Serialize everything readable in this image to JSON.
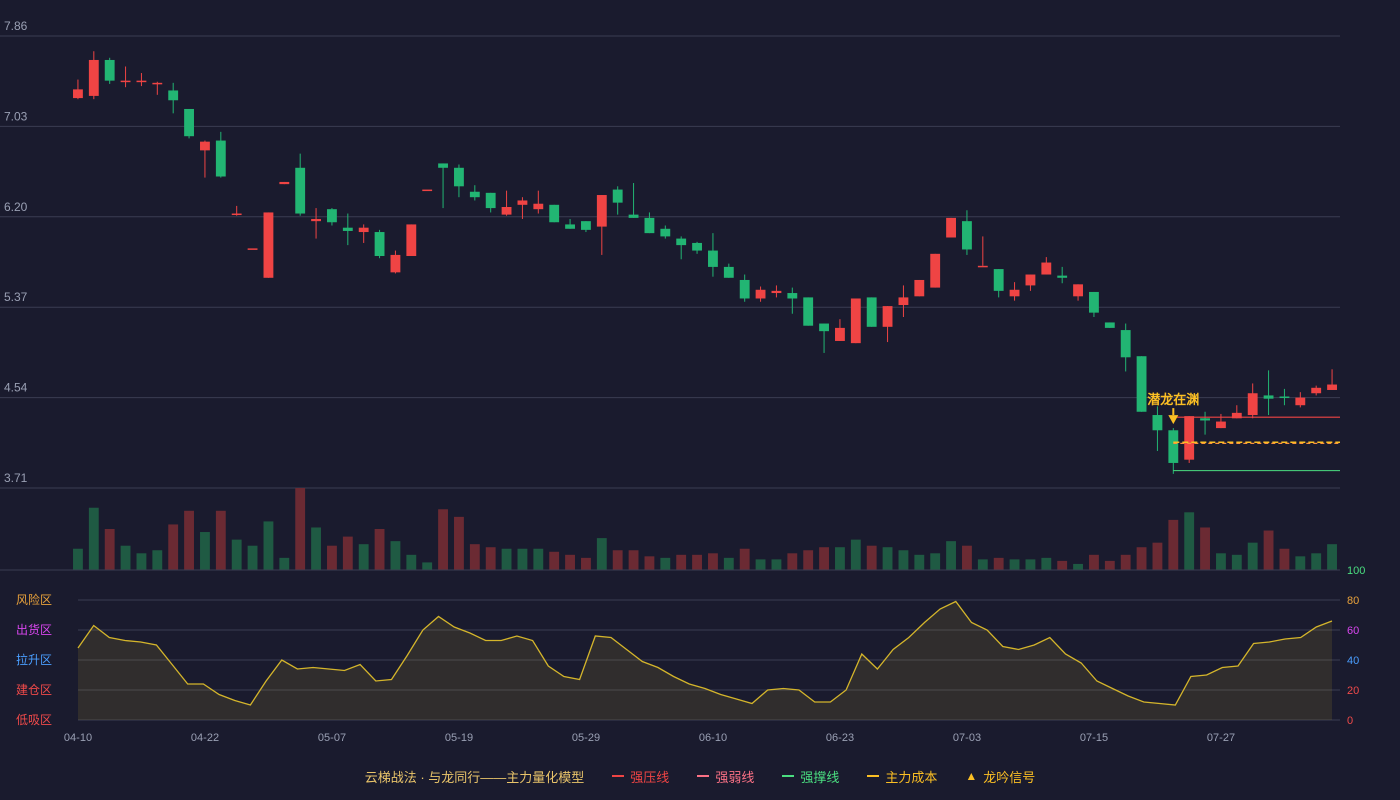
{
  "chart_data": {
    "type": "candlestick",
    "y_ticks": [
      "7.86",
      "7.03",
      "6.20",
      "5.37",
      "4.54",
      "3.71"
    ],
    "ylim": [
      3.71,
      7.86
    ],
    "x_ticks": [
      "04-10",
      "04-22",
      "05-07",
      "05-19",
      "05-29",
      "06-10",
      "06-23",
      "07-03",
      "07-15",
      "07-27"
    ],
    "candles": [
      [
        7.37,
        7.29,
        7.46,
        7.28,
        1
      ],
      [
        7.64,
        7.31,
        7.72,
        7.28,
        1
      ],
      [
        7.45,
        7.64,
        7.66,
        7.42,
        0
      ],
      [
        7.45,
        7.45,
        7.58,
        7.39,
        1
      ],
      [
        7.45,
        7.45,
        7.52,
        7.4,
        1
      ],
      [
        7.42,
        7.43,
        7.44,
        7.32,
        1
      ],
      [
        7.36,
        7.27,
        7.43,
        7.15,
        0
      ],
      [
        7.19,
        6.94,
        7.19,
        6.92,
        0
      ],
      [
        6.89,
        6.81,
        6.9,
        6.56,
        1
      ],
      [
        6.57,
        6.9,
        6.98,
        6.56,
        0
      ],
      [
        6.23,
        6.22,
        6.3,
        6.21,
        1
      ],
      [
        5.91,
        5.91,
        5.91,
        5.91,
        1
      ],
      [
        5.64,
        6.24,
        6.24,
        5.64,
        1
      ],
      [
        6.52,
        6.5,
        6.52,
        6.5,
        1
      ],
      [
        6.23,
        6.65,
        6.78,
        6.21,
        0
      ],
      [
        6.18,
        6.16,
        6.28,
        6.0,
        1
      ],
      [
        6.15,
        6.27,
        6.28,
        6.12,
        0
      ],
      [
        6.1,
        6.07,
        6.23,
        5.94,
        0
      ],
      [
        6.06,
        6.1,
        6.13,
        5.96,
        1
      ],
      [
        5.84,
        6.06,
        6.08,
        5.82,
        0
      ],
      [
        5.69,
        5.85,
        5.89,
        5.68,
        1
      ],
      [
        5.84,
        6.13,
        6.13,
        5.84,
        1
      ],
      [
        6.45,
        6.45,
        6.45,
        6.45,
        1
      ],
      [
        6.69,
        6.65,
        6.69,
        6.28,
        0
      ],
      [
        6.65,
        6.48,
        6.68,
        6.38,
        0
      ],
      [
        6.43,
        6.38,
        6.49,
        6.35,
        0
      ],
      [
        6.42,
        6.28,
        6.42,
        6.24,
        0
      ],
      [
        6.22,
        6.29,
        6.44,
        6.21,
        1
      ],
      [
        6.35,
        6.31,
        6.38,
        6.18,
        1
      ],
      [
        6.32,
        6.27,
        6.44,
        6.23,
        1
      ],
      [
        6.31,
        6.15,
        6.31,
        6.15,
        0
      ],
      [
        6.13,
        6.09,
        6.18,
        6.09,
        0
      ],
      [
        6.08,
        6.16,
        6.16,
        6.06,
        0
      ],
      [
        6.11,
        6.4,
        6.4,
        5.85,
        1
      ],
      [
        6.45,
        6.33,
        6.48,
        6.22,
        0
      ],
      [
        6.22,
        6.19,
        6.51,
        6.19,
        0
      ],
      [
        6.19,
        6.05,
        6.24,
        6.05,
        0
      ],
      [
        6.09,
        6.02,
        6.12,
        6.0,
        0
      ],
      [
        6.0,
        5.94,
        6.02,
        5.81,
        0
      ],
      [
        5.96,
        5.89,
        5.97,
        5.86,
        0
      ],
      [
        5.89,
        5.74,
        6.05,
        5.65,
        0
      ],
      [
        5.74,
        5.64,
        5.77,
        5.64,
        0
      ],
      [
        5.62,
        5.45,
        5.67,
        5.42,
        0
      ],
      [
        5.45,
        5.53,
        5.56,
        5.42,
        1
      ],
      [
        5.5,
        5.52,
        5.57,
        5.46,
        1
      ],
      [
        5.5,
        5.45,
        5.55,
        5.31,
        0
      ],
      [
        5.46,
        5.2,
        5.46,
        5.2,
        0
      ],
      [
        5.22,
        5.15,
        5.22,
        4.95,
        0
      ],
      [
        5.06,
        5.18,
        5.26,
        5.06,
        1
      ],
      [
        5.04,
        5.45,
        5.45,
        5.04,
        1
      ],
      [
        5.46,
        5.19,
        5.46,
        5.19,
        0
      ],
      [
        5.19,
        5.38,
        5.38,
        5.05,
        1
      ],
      [
        5.39,
        5.46,
        5.57,
        5.28,
        1
      ],
      [
        5.47,
        5.62,
        5.62,
        5.47,
        1
      ],
      [
        5.55,
        5.86,
        5.86,
        5.55,
        1
      ],
      [
        6.01,
        6.19,
        6.19,
        6.01,
        1
      ],
      [
        6.16,
        5.9,
        6.26,
        5.85,
        0
      ],
      [
        5.75,
        5.75,
        6.02,
        5.75,
        1
      ],
      [
        5.72,
        5.52,
        5.72,
        5.46,
        0
      ],
      [
        5.47,
        5.53,
        5.6,
        5.43,
        1
      ],
      [
        5.57,
        5.67,
        5.67,
        5.52,
        1
      ],
      [
        5.67,
        5.78,
        5.83,
        5.67,
        1
      ],
      [
        5.66,
        5.64,
        5.74,
        5.59,
        0
      ],
      [
        5.47,
        5.58,
        5.58,
        5.43,
        1
      ],
      [
        5.51,
        5.32,
        5.51,
        5.28,
        0
      ],
      [
        5.23,
        5.18,
        5.23,
        5.18,
        0
      ],
      [
        5.16,
        4.91,
        5.22,
        4.78,
        0
      ],
      [
        4.92,
        4.41,
        4.92,
        4.41,
        0
      ],
      [
        4.38,
        4.24,
        4.46,
        4.05,
        0
      ],
      [
        4.24,
        3.94,
        4.26,
        3.84,
        0
      ],
      [
        3.97,
        4.37,
        4.37,
        3.94,
        1
      ],
      [
        4.35,
        4.33,
        4.41,
        4.2,
        0
      ],
      [
        4.32,
        4.26,
        4.39,
        4.26,
        1
      ],
      [
        4.35,
        4.4,
        4.47,
        4.35,
        1
      ],
      [
        4.38,
        4.58,
        4.67,
        4.35,
        1
      ],
      [
        4.56,
        4.53,
        4.79,
        4.38,
        0
      ],
      [
        4.55,
        4.55,
        4.62,
        4.47,
        0
      ],
      [
        4.47,
        4.54,
        4.59,
        4.45,
        1
      ],
      [
        4.58,
        4.63,
        4.65,
        4.56,
        1
      ],
      [
        4.61,
        4.66,
        4.8,
        4.61,
        1
      ]
    ],
    "volume": [
      [
        14,
        0
      ],
      [
        41,
        0
      ],
      [
        27,
        1
      ],
      [
        16,
        0
      ],
      [
        11,
        0
      ],
      [
        13,
        0
      ],
      [
        30,
        1
      ],
      [
        39,
        1
      ],
      [
        25,
        0
      ],
      [
        39,
        1
      ],
      [
        20,
        0
      ],
      [
        16,
        0
      ],
      [
        32,
        0
      ],
      [
        8,
        0
      ],
      [
        54,
        1
      ],
      [
        28,
        0
      ],
      [
        16,
        1
      ],
      [
        22,
        1
      ],
      [
        17,
        0
      ],
      [
        27,
        1
      ],
      [
        19,
        0
      ],
      [
        10,
        0
      ],
      [
        5,
        0
      ],
      [
        40,
        1
      ],
      [
        35,
        1
      ],
      [
        17,
        1
      ],
      [
        15,
        1
      ],
      [
        14,
        0
      ],
      [
        14,
        0
      ],
      [
        14,
        0
      ],
      [
        12,
        1
      ],
      [
        10,
        1
      ],
      [
        8,
        1
      ],
      [
        21,
        0
      ],
      [
        13,
        1
      ],
      [
        13,
        1
      ],
      [
        9,
        1
      ],
      [
        8,
        0
      ],
      [
        10,
        1
      ],
      [
        10,
        1
      ],
      [
        11,
        1
      ],
      [
        8,
        0
      ],
      [
        14,
        1
      ],
      [
        7,
        0
      ],
      [
        7,
        0
      ],
      [
        11,
        1
      ],
      [
        13,
        1
      ],
      [
        15,
        1
      ],
      [
        15,
        0
      ],
      [
        20,
        0
      ],
      [
        16,
        1
      ],
      [
        15,
        0
      ],
      [
        13,
        0
      ],
      [
        10,
        0
      ],
      [
        11,
        0
      ],
      [
        19,
        0
      ],
      [
        16,
        1
      ],
      [
        7,
        0
      ],
      [
        8,
        1
      ],
      [
        7,
        0
      ],
      [
        7,
        0
      ],
      [
        8,
        0
      ],
      [
        6,
        1
      ],
      [
        4,
        0
      ],
      [
        10,
        1
      ],
      [
        6,
        1
      ],
      [
        10,
        1
      ],
      [
        15,
        1
      ],
      [
        18,
        1
      ],
      [
        33,
        1
      ],
      [
        38,
        0
      ],
      [
        28,
        1
      ],
      [
        11,
        0
      ],
      [
        10,
        0
      ],
      [
        18,
        0
      ],
      [
        26,
        1
      ],
      [
        14,
        1
      ],
      [
        9,
        0
      ],
      [
        11,
        0
      ],
      [
        17,
        0
      ]
    ],
    "volume_scale_label": "100",
    "osc": [
      48,
      63,
      55,
      53,
      52,
      50,
      37,
      24,
      24,
      17,
      13,
      10,
      26,
      40,
      34,
      35,
      34,
      33,
      37,
      26,
      27,
      43,
      60,
      69,
      62,
      58,
      53,
      53,
      56,
      53,
      36,
      29,
      27,
      56,
      55,
      47,
      39,
      35,
      29,
      24,
      21,
      17,
      14,
      11,
      20,
      21,
      20,
      12,
      12,
      20,
      44,
      34,
      47,
      55,
      65,
      74,
      79,
      65,
      60,
      49,
      47,
      50,
      55,
      44,
      38,
      26,
      21,
      16,
      12,
      11,
      10,
      29,
      30,
      35,
      36,
      51,
      52,
      54,
      55,
      62,
      66
    ],
    "osc_ylim": [
      0,
      100
    ],
    "osc_ticks": [
      "0",
      "20",
      "40",
      "60",
      "80"
    ],
    "zones": [
      {
        "label": "风险区",
        "value": 80,
        "color": "#e9a23b"
      },
      {
        "label": "出货区",
        "value": 60,
        "color": "#d946ef"
      },
      {
        "label": "拉升区",
        "value": 40,
        "color": "#4a9eff"
      },
      {
        "label": "建仓区",
        "value": 20,
        "color": "#f04a4a"
      },
      {
        "label": "低吸区",
        "value": 0,
        "color": "#f04a4a"
      }
    ],
    "lines": {
      "pressure": {
        "value": 4.36,
        "from": 69,
        "color": "#ef4444"
      },
      "weak": {
        "value": 4.12,
        "from": 69,
        "color": "#fb923c"
      },
      "support": {
        "value": 3.87,
        "from": 69,
        "color": "#4ade80"
      },
      "cost": {
        "value": 4.13,
        "from": 69,
        "color": "#fbbf24"
      }
    },
    "signal": {
      "label": "潜龙在渊",
      "index": 69,
      "color": "#fbbf24"
    },
    "colors": {
      "up": "#ef4444",
      "down": "#22b573",
      "vol_up": "#6b2a33",
      "vol_down": "#1f5a43",
      "osc_line": "#d4b52b",
      "grid": "#3a3c52",
      "axis_text": "#9aa0b4",
      "green_text": "#4ade80"
    }
  },
  "legend": {
    "title": "云梯战法 · 与龙同行——主力量化模型",
    "items": [
      {
        "label": "强压线",
        "color": "#ef4444",
        "style": "solid"
      },
      {
        "label": "强弱线",
        "color": "#fb7185",
        "style": "dashed"
      },
      {
        "label": "强撑线",
        "color": "#4ade80",
        "style": "solid"
      },
      {
        "label": "主力成本",
        "color": "#fbbf24",
        "style": "dashed"
      },
      {
        "label": "龙吟信号",
        "color": "#fbbf24",
        "style": "triangle"
      }
    ]
  }
}
